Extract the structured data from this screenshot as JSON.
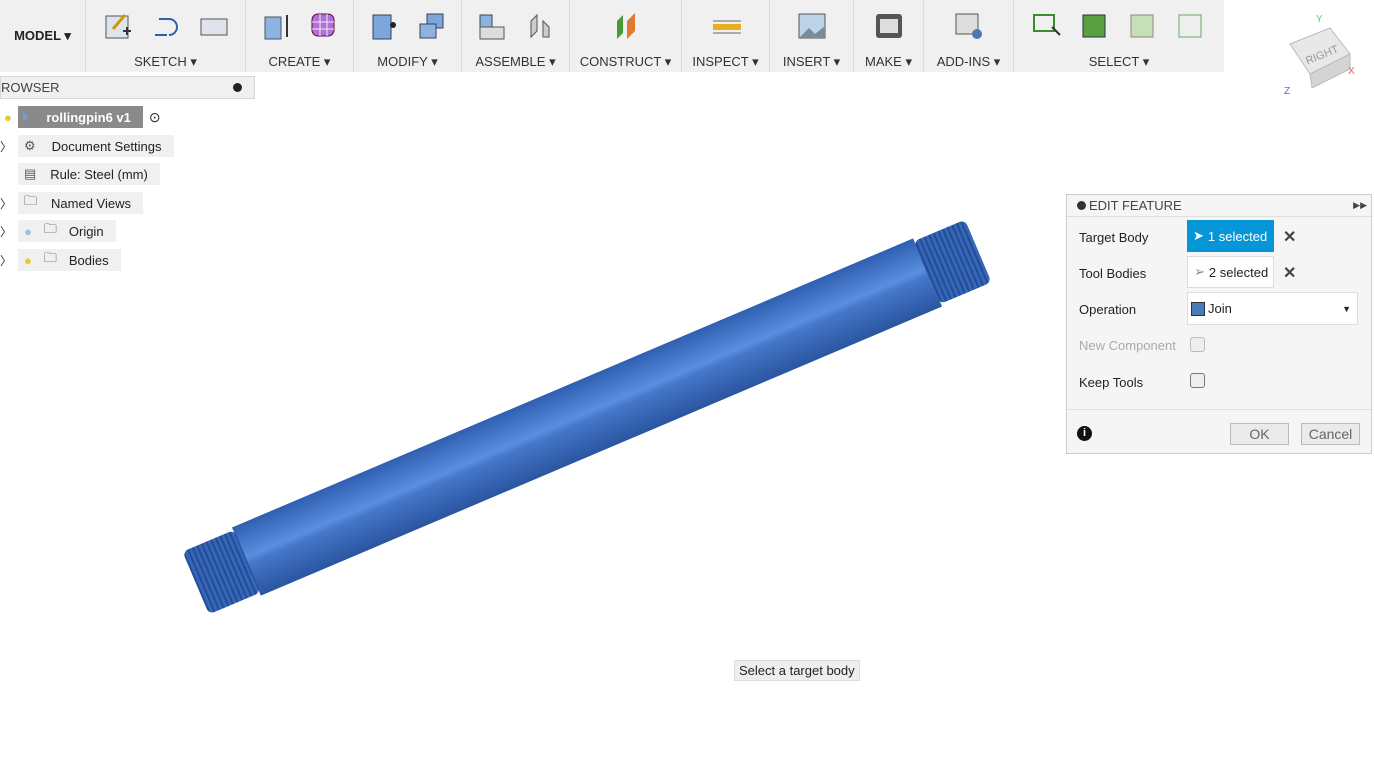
{
  "toolbar": {
    "model": "MODEL ▾",
    "groups": [
      {
        "label": "SKETCH ▾"
      },
      {
        "label": "CREATE ▾"
      },
      {
        "label": "MODIFY ▾"
      },
      {
        "label": "ASSEMBLE ▾"
      },
      {
        "label": "CONSTRUCT ▾"
      },
      {
        "label": "INSPECT ▾"
      },
      {
        "label": "INSERT ▾"
      },
      {
        "label": "MAKE ▾"
      },
      {
        "label": "ADD-INS ▾"
      },
      {
        "label": "SELECT ▾"
      }
    ]
  },
  "viewcube": {
    "face": "RIGHT",
    "axes": [
      "Y",
      "X",
      "Z"
    ]
  },
  "browser": {
    "title": "ROWSER",
    "root": "rollingpin6 v1",
    "items": [
      {
        "label": "Document Settings",
        "icon": "gear-icon"
      },
      {
        "label": "Rule: Steel (mm)",
        "icon": "rule-icon"
      },
      {
        "label": "Named Views",
        "icon": "folder-icon"
      },
      {
        "label": "Origin",
        "icon": "folder-icon"
      },
      {
        "label": "Bodies",
        "icon": "folder-icon"
      }
    ]
  },
  "panel": {
    "title": "EDIT FEATURE",
    "target_label": "Target Body",
    "target_value": "1 selected",
    "tool_label": "Tool Bodies",
    "tool_value": "2 selected",
    "operation_label": "Operation",
    "operation_value": "Join",
    "new_component_label": "New Component",
    "keep_tools_label": "Keep Tools",
    "ok": "OK",
    "cancel": "Cancel"
  },
  "hint": "Select a target body",
  "colors": {
    "accent": "#0696d7",
    "body": "#3f73c4"
  }
}
